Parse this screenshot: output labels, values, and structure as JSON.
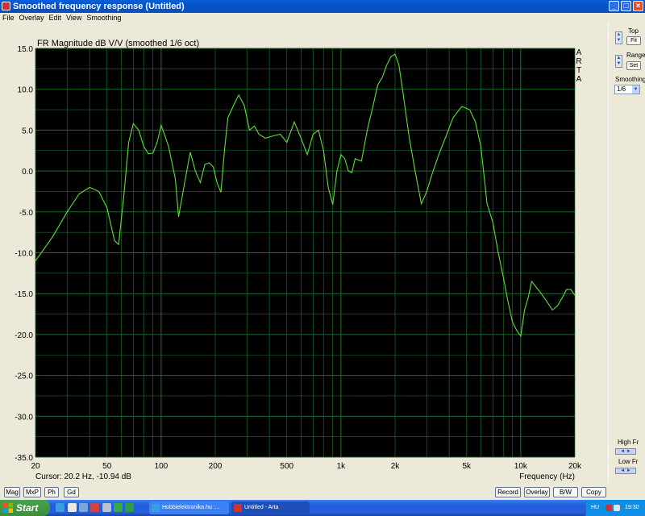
{
  "window": {
    "title": "Smoothed frequency response (Untitled)"
  },
  "menu": {
    "items": [
      "File",
      "Overlay",
      "Edit",
      "View",
      "Smoothing"
    ]
  },
  "chart_data": {
    "type": "line",
    "title": "FR Magnitude dB V/V (smoothed 1/6 oct)",
    "xlabel": "Frequency (Hz)",
    "ylabel": "",
    "xscale": "log",
    "xlim": [
      20,
      20000
    ],
    "ylim": [
      -35,
      15
    ],
    "grid": true,
    "background": "#000000",
    "line_color": "#5ddf3a",
    "grid_color": "#1e6a2a",
    "ytick_labels": [
      "15.0",
      "10.0",
      "5.0",
      "0.0",
      "-5.0",
      "-10.0",
      "-15.0",
      "-20.0",
      "-25.0",
      "-30.0",
      "-35.0"
    ],
    "ytick_values": [
      15,
      10,
      5,
      0,
      -5,
      -10,
      -15,
      -20,
      -25,
      -30,
      -35
    ],
    "xtick_labels": [
      "20",
      "50",
      "100",
      "200",
      "500",
      "1k",
      "2k",
      "5k",
      "10k",
      "20k"
    ],
    "xtick_values": [
      20,
      50,
      100,
      200,
      500,
      1000,
      2000,
      5000,
      10000,
      20000
    ],
    "watermark": "ARTA",
    "series": [
      {
        "x": [
          20,
          25,
          30,
          35,
          40,
          45,
          50,
          55,
          58,
          62,
          66,
          70,
          75,
          80,
          85,
          90,
          95,
          100,
          110,
          120,
          125,
          135,
          145,
          155,
          165,
          175,
          185,
          195,
          205,
          215,
          225,
          235,
          250,
          270,
          290,
          310,
          330,
          350,
          380,
          420,
          460,
          500,
          550,
          600,
          650,
          700,
          750,
          800,
          850,
          900,
          950,
          1000,
          1050,
          1100,
          1150,
          1200,
          1300,
          1400,
          1500,
          1600,
          1700,
          1800,
          1900,
          2000,
          2100,
          2200,
          2400,
          2600,
          2800,
          3000,
          3200,
          3500,
          3800,
          4200,
          4700,
          5200,
          5600,
          6000,
          6500,
          7000,
          7500,
          8000,
          8500,
          9000,
          9500,
          10000,
          10500,
          11000,
          11500,
          12000,
          13000,
          14000,
          15000,
          16000,
          17000,
          18000,
          19000,
          20000
        ],
        "y": [
          -11,
          -8,
          -5,
          -2.8,
          -2,
          -2.5,
          -4.5,
          -8.5,
          -9,
          -3,
          3.5,
          5.8,
          5,
          3,
          2.1,
          2.2,
          3.5,
          5.6,
          3,
          -1,
          -5.6,
          -1.5,
          2.3,
          0,
          -1.4,
          0.8,
          1,
          0.5,
          -1.5,
          -2.6,
          2.5,
          6.5,
          7.8,
          9.3,
          8,
          5,
          5.5,
          4.5,
          4,
          4.3,
          4.5,
          3.5,
          6,
          4,
          2,
          4.5,
          5,
          2.5,
          -2,
          -4.1,
          0,
          2,
          1.5,
          0,
          -0.2,
          1.5,
          1.2,
          5,
          7.7,
          10.5,
          11.5,
          13,
          14,
          14.3,
          13,
          10,
          4,
          -0.3,
          -4,
          -2.5,
          -0.5,
          2,
          4,
          6.5,
          7.9,
          7.5,
          6,
          3,
          -4,
          -6.3,
          -10,
          -13,
          -16,
          -18.5,
          -19.5,
          -20.2,
          -17,
          -15.5,
          -13.5,
          -14,
          -15,
          -16,
          -17,
          -16.5,
          -15.5,
          -14.5,
          -14.5,
          -15.2
        ]
      }
    ]
  },
  "cursor_readout": "Cursor: 20.2 Hz, -10.94 dB",
  "right_panel": {
    "top_label": "Top",
    "fit_button": "Fit",
    "range_label": "Range",
    "set_button": "Set",
    "smoothing_label": "Smoothing",
    "smoothing_value": "1/6",
    "high_fr_label": "High Fr",
    "low_fr_label": "Low Fr"
  },
  "bottom_buttons": {
    "left": [
      "Mag",
      "MxP",
      "Ph",
      "Gd"
    ],
    "right": [
      "Record",
      "Overlay",
      "B/W",
      "Copy"
    ]
  },
  "taskbar": {
    "start_label": "Start",
    "tasks": [
      "Hobbielektronika.hu :...",
      "Untitled - Arta"
    ],
    "language": "HU",
    "clock": "19:30"
  }
}
